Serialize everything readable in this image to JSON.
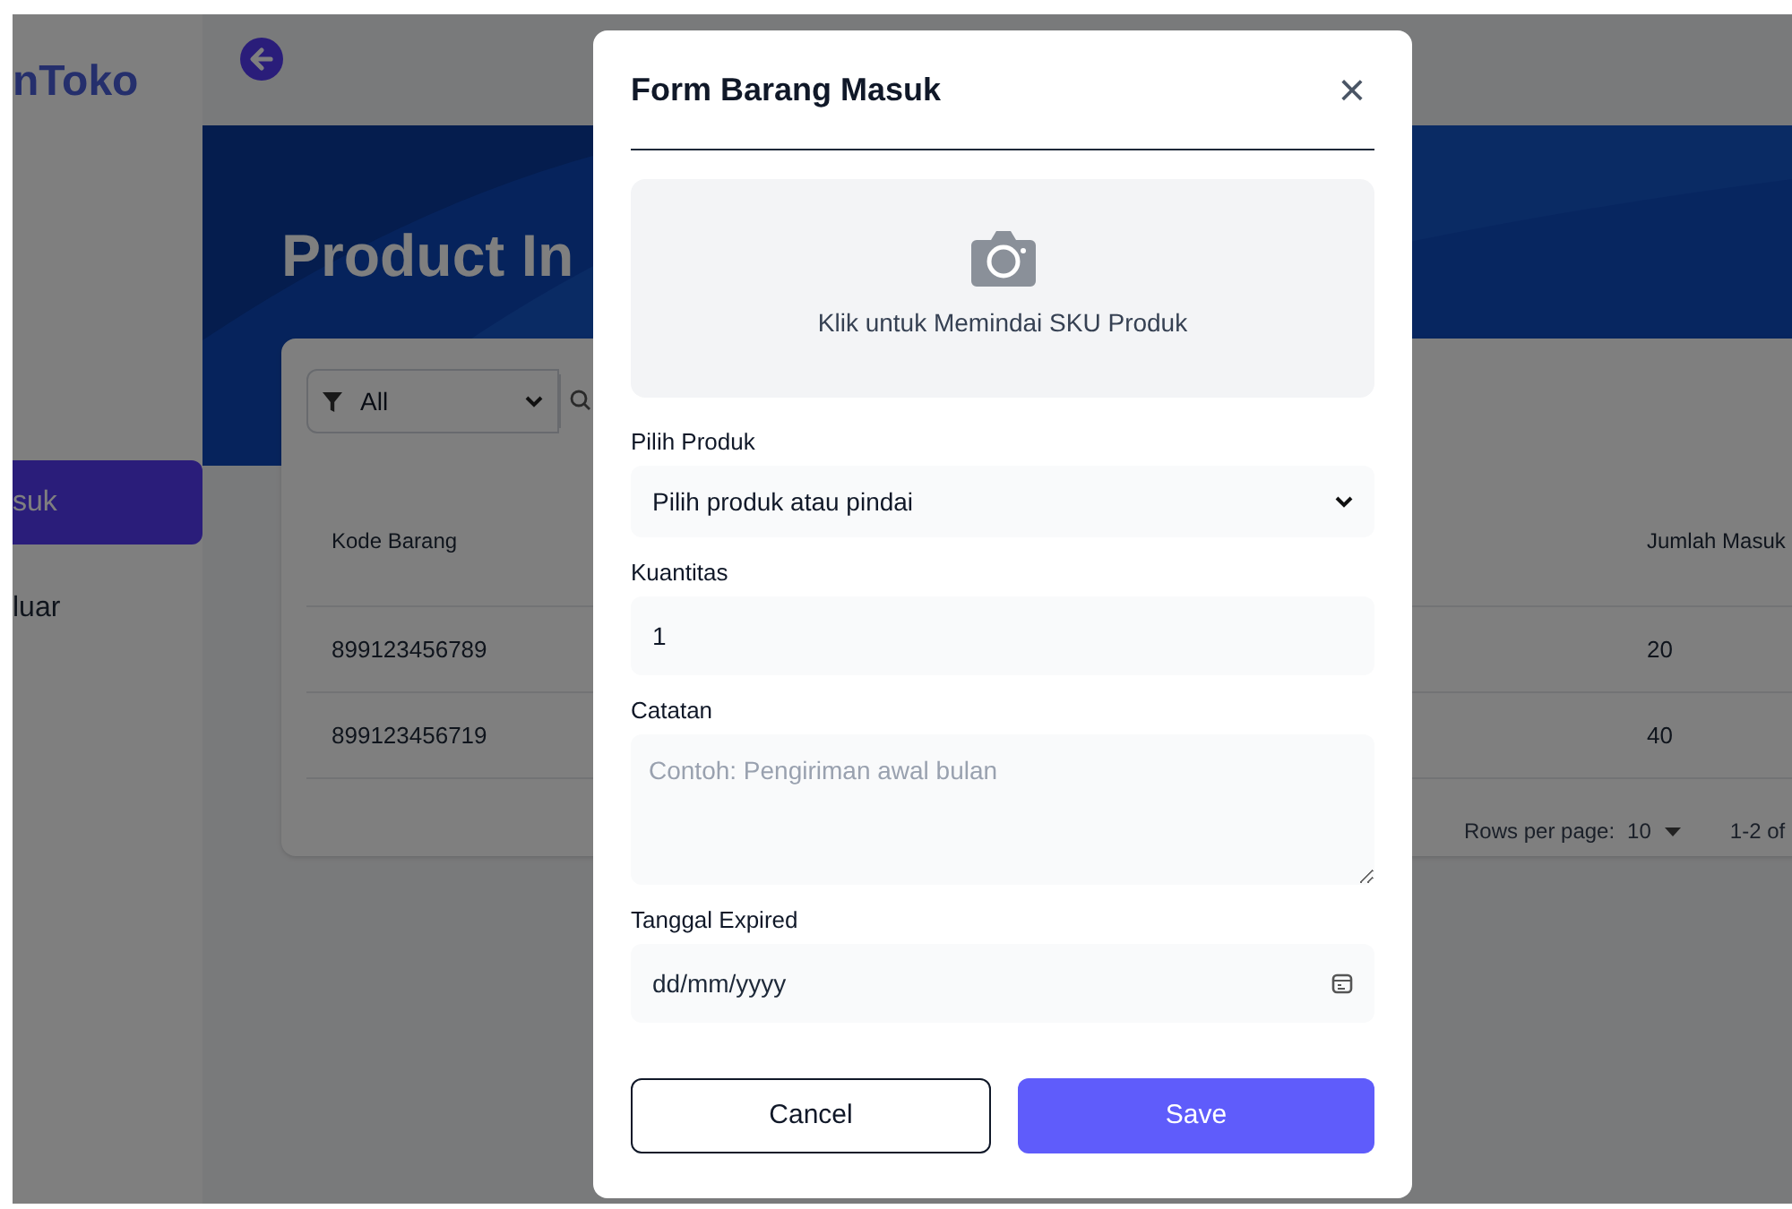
{
  "sidebar": {
    "logo": "nToko",
    "items": [
      {
        "label": "suk",
        "selected": true
      },
      {
        "label": "luar",
        "selected": false
      }
    ]
  },
  "page": {
    "title": "Product In",
    "filter": {
      "value": "All"
    },
    "table": {
      "columns": [
        "Kode Barang",
        "Jumlah Masuk"
      ],
      "rows": [
        [
          "899123456789",
          "20"
        ],
        [
          "899123456719",
          "40"
        ]
      ]
    },
    "pagination": {
      "rows_per_page_label": "Rows per page:",
      "rows_per_page": "10",
      "range": "1-2 of"
    }
  },
  "modal": {
    "title": "Form Barang Masuk",
    "close": "×",
    "scan_text": "Klik untuk Memindai SKU Produk",
    "fields": [
      {
        "kind": "select",
        "label": "Pilih Produk",
        "value": "Pilih produk atau pindai"
      },
      {
        "kind": "input",
        "label": "Kuantitas",
        "value": "1"
      },
      {
        "kind": "textarea",
        "label": "Catatan",
        "placeholder": "Contoh: Pengiriman awal bulan"
      },
      {
        "kind": "date",
        "label": "Tanggal Expired",
        "value": "dd/mm/yyyy"
      }
    ],
    "buttons": [
      {
        "kind": "secondary",
        "label": "Cancel"
      },
      {
        "kind": "primary",
        "label": "Save"
      }
    ]
  }
}
